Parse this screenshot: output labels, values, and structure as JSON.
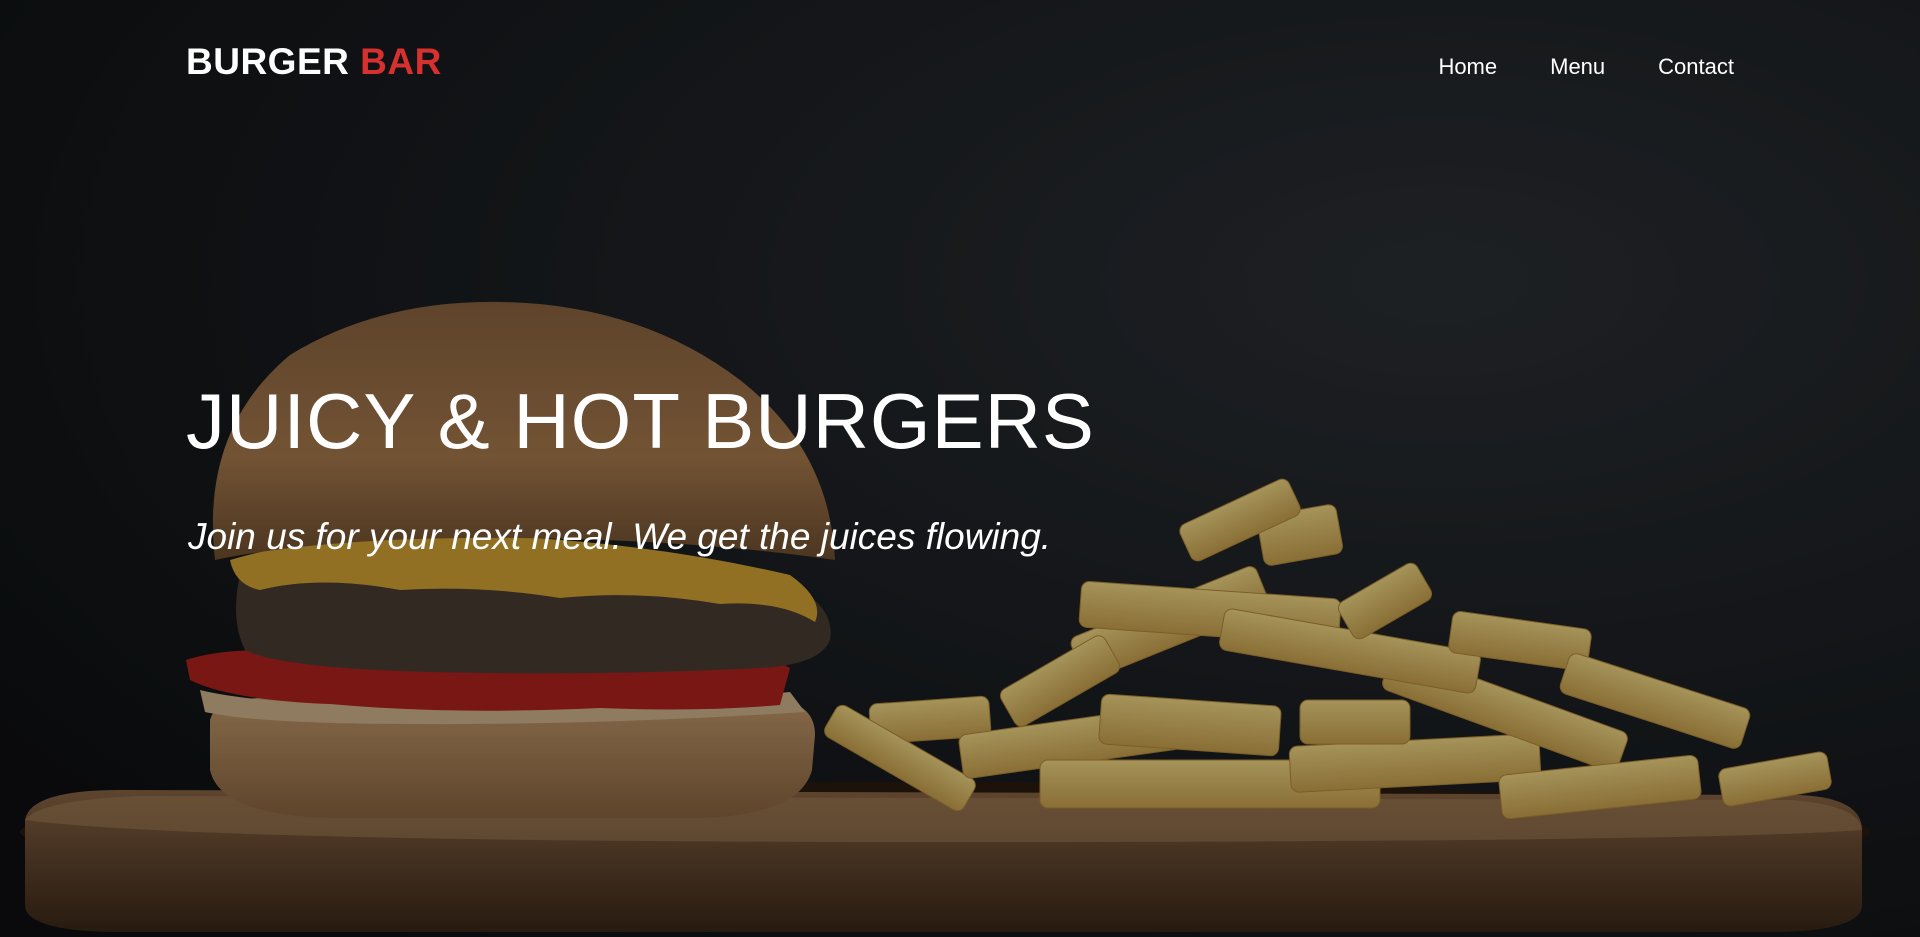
{
  "brand": {
    "name_main": "BURGER",
    "name_accent": "BAR",
    "accent_color": "#d6302f"
  },
  "nav": {
    "items": [
      {
        "label": "Home"
      },
      {
        "label": "Menu"
      },
      {
        "label": "Contact"
      }
    ]
  },
  "hero": {
    "title": "JUICY & HOT BURGERS",
    "subtitle": "Join us for your next meal. We get the juices flowing.",
    "image_subject": "burger-and-fries-photo"
  }
}
